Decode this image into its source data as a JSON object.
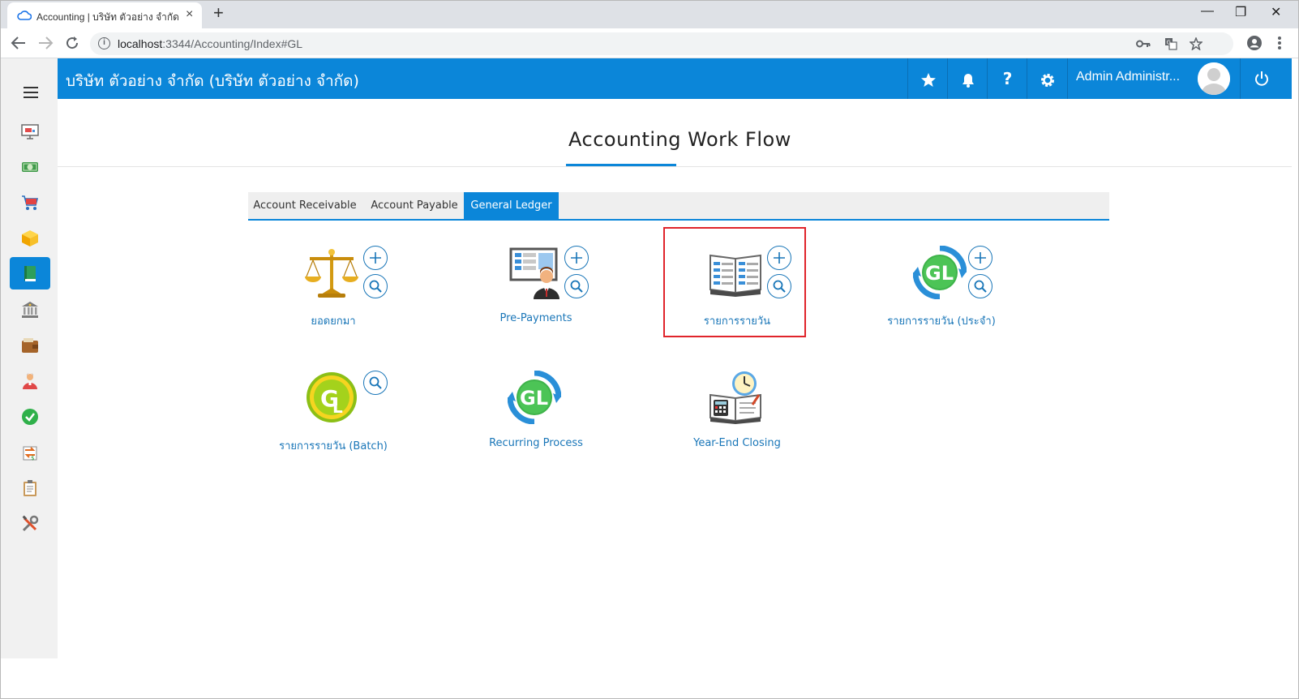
{
  "browser": {
    "tab_title": "Accounting | บริษัท ตัวอย่าง จำกัด | บ",
    "tab_close": "×",
    "new_tab": "+",
    "url_host": "localhost",
    "url_rest": ":3344/Accounting/Index#GL",
    "window_controls": [
      "—",
      "❐",
      "✕"
    ]
  },
  "header": {
    "company": "บริษัท ตัวอย่าง จำกัด (บริษัท ตัวอย่าง จำกัด)",
    "help": "?",
    "user_name": "Admin Administr...",
    "accent_color": "#0b86d9"
  },
  "sidebar": {
    "items": [
      {
        "icon": "presentation-icon"
      },
      {
        "icon": "money-icon"
      },
      {
        "icon": "cart-icon"
      },
      {
        "icon": "box-icon"
      },
      {
        "icon": "ledger-book-icon",
        "active": true
      },
      {
        "icon": "bank-icon"
      },
      {
        "icon": "wallet-icon"
      },
      {
        "icon": "people-icon"
      },
      {
        "icon": "check-circle-icon"
      },
      {
        "icon": "transfer-icon"
      },
      {
        "icon": "clipboard-icon"
      },
      {
        "icon": "tools-icon"
      }
    ]
  },
  "main": {
    "title": "Accounting Work Flow",
    "tabs": [
      {
        "label": "Account Receivable"
      },
      {
        "label": "Account Payable"
      },
      {
        "label": "General Ledger",
        "active": true
      }
    ],
    "tiles": [
      {
        "label": "ยอดยกมา",
        "icon": "scales-icon"
      },
      {
        "label": "Pre-Payments",
        "icon": "presenter-icon"
      },
      {
        "label": "รายการรายวัน",
        "icon": "journal-book-icon"
      },
      {
        "label": "รายการรายวัน (ประจำ)",
        "icon": "gl-recurring-icon"
      },
      {
        "label": "รายการรายวัน (Batch)",
        "icon": "gl-batch-icon"
      },
      {
        "label": "Recurring Process",
        "icon": "gl-process-icon"
      },
      {
        "label": "Year-End Closing",
        "icon": "year-end-icon"
      }
    ]
  }
}
